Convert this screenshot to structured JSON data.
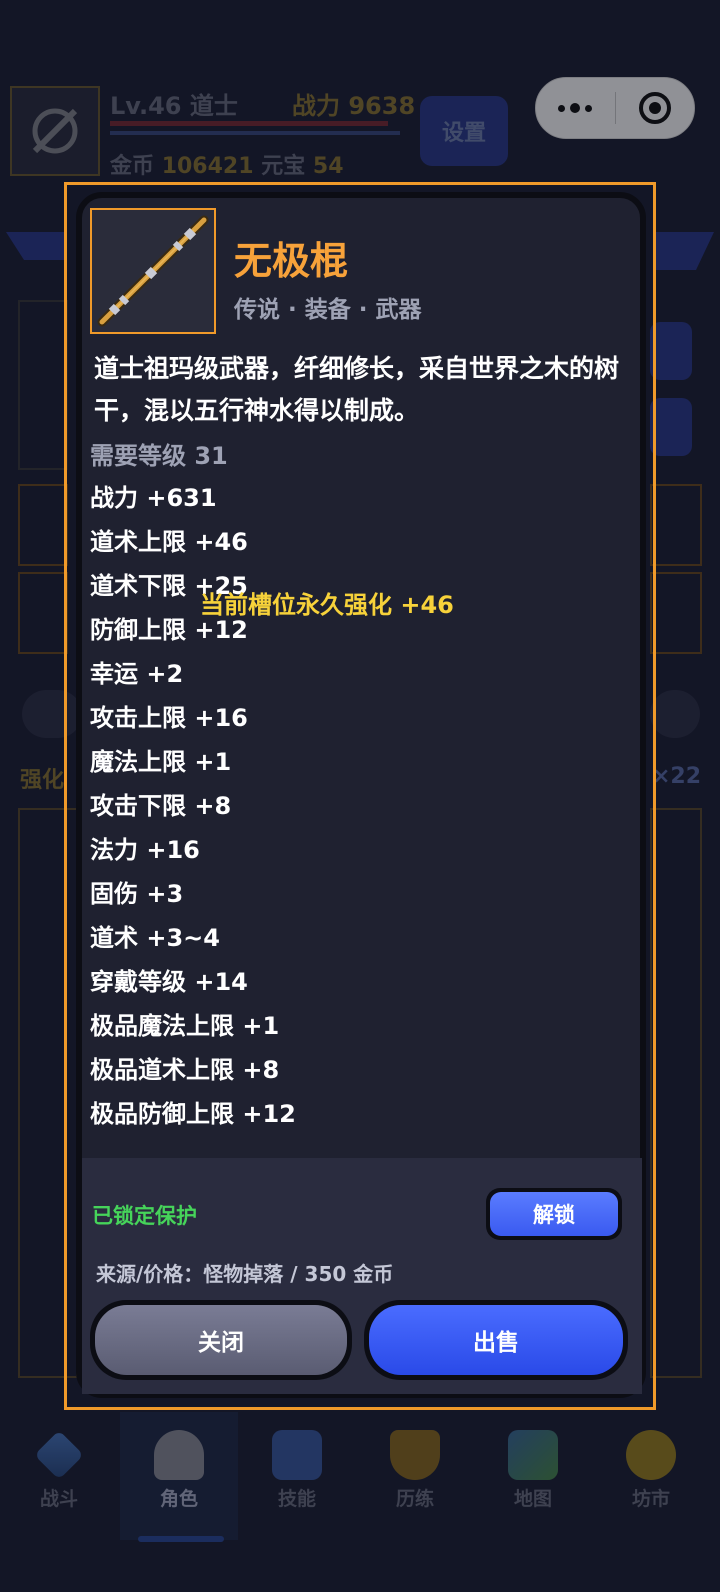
{
  "hud": {
    "level": "Lv.46 道士",
    "power_label": "战力",
    "power_value": "9638",
    "gold_label": "金币",
    "gold_value": "106421",
    "ingot_label": "元宝",
    "ingot_value": "54",
    "settings_label": "设置"
  },
  "background": {
    "strengthen_label": "强化",
    "strengthen_count": "×22"
  },
  "item": {
    "name": "无极棍",
    "tags": "传说 · 装备 · 武器",
    "description": "道士祖玛级武器，纤细修长，采自世界之木的树干，混以五行神水得以制成。",
    "required_level": "需要等级 31",
    "slot_bonus": "当前槽位永久强化 +46",
    "stats": [
      "战力 +631",
      "道术上限 +46",
      "道术下限 +25",
      "防御上限 +12",
      "幸运 +2",
      "攻击上限 +16",
      "魔法上限 +1",
      "攻击下限 +8",
      "法力 +16",
      "固伤 +3",
      "道术 +3~4",
      "穿戴等级 +14",
      "极品魔法上限 +1",
      "极品道术上限 +8",
      "极品防御上限 +12"
    ],
    "lock_status": "已锁定保护",
    "unlock_label": "解锁",
    "source": "来源/价格：怪物掉落 / 350 金币",
    "close_label": "关闭",
    "sell_label": "出售"
  },
  "tabs": [
    {
      "label": "战斗",
      "icon": "sword-icon"
    },
    {
      "label": "角色",
      "icon": "helmet-icon"
    },
    {
      "label": "技能",
      "icon": "potion-icon"
    },
    {
      "label": "历练",
      "icon": "trophy-icon"
    },
    {
      "label": "地图",
      "icon": "map-icon"
    },
    {
      "label": "坊市",
      "icon": "coin-icon"
    }
  ],
  "colors": {
    "accent_orange": "#f09a2a",
    "item_name": "#f7a23a",
    "slot_bonus": "#f7d23a",
    "locked_green": "#46d45a",
    "primary_blue": "#3a5af0"
  }
}
